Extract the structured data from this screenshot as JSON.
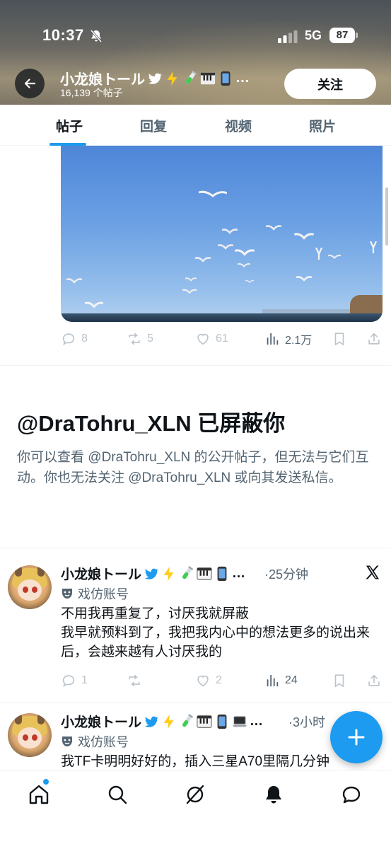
{
  "status_bar": {
    "time": "10:37",
    "network": "5G",
    "battery": "87"
  },
  "header": {
    "name": "小龙娘トール",
    "post_count": "16,139 个帖子",
    "follow_label": "关注",
    "more": "…"
  },
  "tabs": [
    {
      "label": "帖子",
      "active": true
    },
    {
      "label": "回复",
      "active": false
    },
    {
      "label": "视频",
      "active": false
    },
    {
      "label": "照片",
      "active": false
    }
  ],
  "top_post": {
    "replies": "8",
    "reposts": "5",
    "likes": "61",
    "views": "2.1万"
  },
  "blocked": {
    "title": "@DraTohru_XLN 已屏蔽你",
    "message": "你可以查看 @DraTohru_XLN 的公开帖子，但无法与它们互动。你也无法关注 @DraTohru_XLN 或向其发送私信。"
  },
  "tweets": [
    {
      "name": "小龙娘トール",
      "more": "…",
      "time": "·25分钟",
      "label": "戏仿账号",
      "lines": [
        "不用我再重复了，讨厌我就屏蔽",
        "我早就预料到了，我把我内心中的想法更多的说出来后，会越来越有人讨厌我的"
      ],
      "replies": "1",
      "likes": "2",
      "views": "24"
    },
    {
      "name": "小龙娘トール",
      "more": "…",
      "time": "·3小时",
      "label": "戏仿账号",
      "lines": [
        "我TF卡明明好好的，插入三星A70里隔几分钟"
      ]
    }
  ],
  "colors": {
    "accent": "#1d9bf0",
    "text": "#0f1419",
    "muted": "#536471"
  },
  "icons": [
    "back-arrow-icon",
    "verified-bird-icon",
    "lightning-icon",
    "test-tube-icon",
    "piano-icon",
    "phone-icon",
    "laptop-icon",
    "reply-icon",
    "repost-icon",
    "like-icon",
    "views-icon",
    "bookmark-icon",
    "share-icon",
    "x-logo-icon",
    "parody-mask-icon",
    "compose-plus-icon",
    "home-icon",
    "search-icon",
    "grok-icon",
    "notifications-icon",
    "messages-icon"
  ]
}
